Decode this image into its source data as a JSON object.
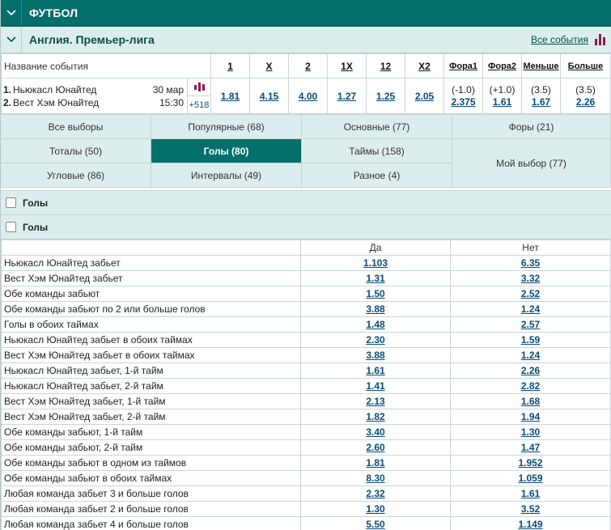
{
  "sport": {
    "title": "ФУТБОЛ"
  },
  "league": {
    "title": "Англия. Премьер-лига",
    "all_events": "Все события"
  },
  "event_table": {
    "name_header": "Название события",
    "headers": [
      "1",
      "X",
      "2",
      "1X",
      "12",
      "X2",
      "Фора1",
      "Фора2",
      "Меньше",
      "Больше"
    ],
    "event": {
      "team1_num": "1.",
      "team1": "Ньюкасл Юнайтед",
      "team2_num": "2.",
      "team2": "Вест Хэм Юнайтед",
      "date": "30 мар",
      "time": "15:30",
      "more": "+518",
      "odds": [
        "1.81",
        "4.15",
        "4.00",
        "1.27",
        "1.25",
        "2.05"
      ],
      "handicap1_param": "(-1.0)",
      "handicap1_odd": "2.375",
      "handicap2_param": "(+1.0)",
      "handicap2_odd": "1.61",
      "under_param": "(3.5)",
      "under_odd": "1.67",
      "over_param": "(3.5)",
      "over_odd": "2.26"
    }
  },
  "filters": [
    {
      "label": "Все выборы"
    },
    {
      "label": "Популярные (68)"
    },
    {
      "label": "Основные (77)"
    },
    {
      "label": "Форы (21)"
    },
    {
      "label": "Тоталы (50)"
    },
    {
      "label": "Голы (80)"
    },
    {
      "label": "Таймы (158)"
    },
    {
      "label": "Мой выбор (77)"
    },
    {
      "label": "Угловые (86)"
    },
    {
      "label": "Интервалы (49)"
    },
    {
      "label": "Разное (4)"
    }
  ],
  "sections": [
    {
      "title": "Голы"
    },
    {
      "title": "Голы"
    }
  ],
  "market": {
    "col_yes": "Да",
    "col_no": "Нет",
    "rows": [
      {
        "label": "Ньюкасл Юнайтед забьет",
        "yes": "1.103",
        "no": "6.35"
      },
      {
        "label": "Вест Хэм Юнайтед забьет",
        "yes": "1.31",
        "no": "3.32"
      },
      {
        "label": "Обе команды забьют",
        "yes": "1.50",
        "no": "2.52"
      },
      {
        "label": "Обе команды забьют по 2 или больше голов",
        "yes": "3.88",
        "no": "1.24"
      },
      {
        "label": "Голы в обоих таймах",
        "yes": "1.48",
        "no": "2.57"
      },
      {
        "label": "Ньюкасл Юнайтед забьет в обоих таймах",
        "yes": "2.30",
        "no": "1.59"
      },
      {
        "label": "Вест Хэм Юнайтед забьет в обоих таймах",
        "yes": "3.88",
        "no": "1.24"
      },
      {
        "label": "Ньюкасл Юнайтед забьет, 1-й тайм",
        "yes": "1.61",
        "no": "2.26"
      },
      {
        "label": "Ньюкасл Юнайтед забьет, 2-й тайм",
        "yes": "1.41",
        "no": "2.82"
      },
      {
        "label": "Вест Хэм Юнайтед забьет, 1-й тайм",
        "yes": "2.13",
        "no": "1.68"
      },
      {
        "label": "Вест Хэм Юнайтед забьет, 2-й тайм",
        "yes": "1.82",
        "no": "1.94"
      },
      {
        "label": "Обе команды забьют, 1-й тайм",
        "yes": "3.40",
        "no": "1.30"
      },
      {
        "label": "Обе команды забьют, 2-й тайм",
        "yes": "2.60",
        "no": "1.47"
      },
      {
        "label": "Обе команды забьют в одном из таймов",
        "yes": "1.81",
        "no": "1.952"
      },
      {
        "label": "Обе команды забьют в обоих таймах",
        "yes": "8.30",
        "no": "1.059"
      },
      {
        "label": "Любая команда забьет 3 и больше голов",
        "yes": "2.32",
        "no": "1.61"
      },
      {
        "label": "Любая команда забьет 2 и больше голов",
        "yes": "1.30",
        "no": "3.52"
      },
      {
        "label": "Любая команда забьет 4 и больше голов",
        "yes": "5.50",
        "no": "1.149"
      }
    ]
  },
  "colors": {
    "dark_teal": "#05706b",
    "light_teal": "#dbeeed",
    "link": "#0a4b76",
    "stats": "#8c1e4f"
  }
}
